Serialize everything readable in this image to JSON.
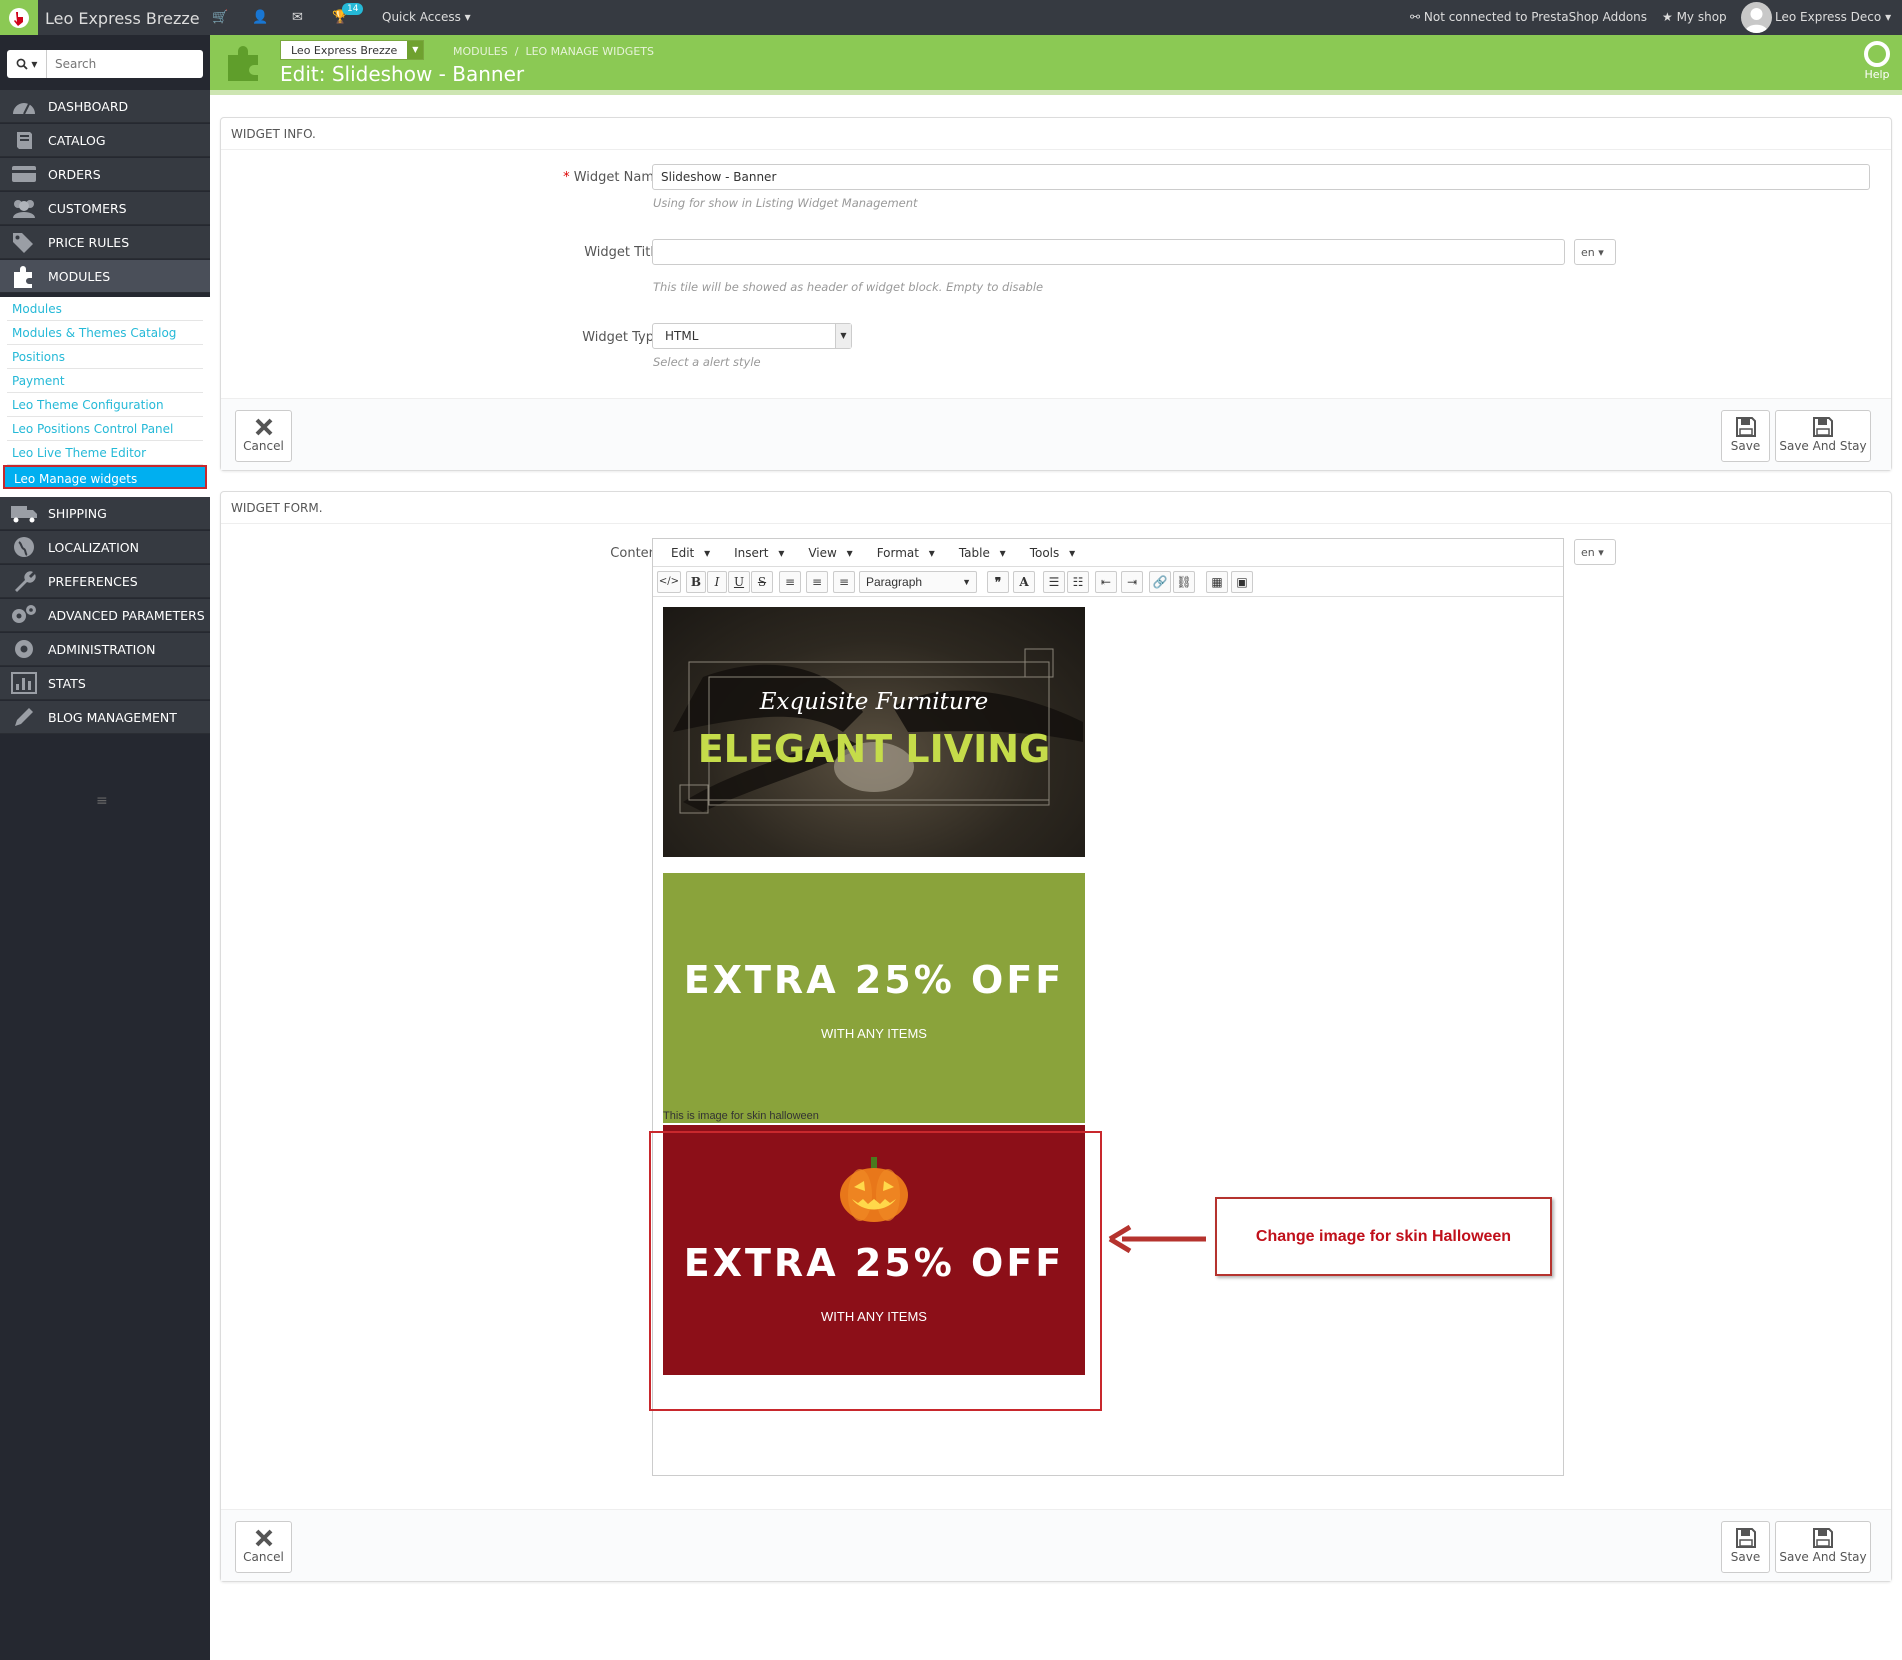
{
  "topbar": {
    "shop_name": "Leo Express Brezze",
    "notifications_count": "14",
    "quick_access": "Quick Access",
    "addons_status": "Not connected to PrestaShop Addons",
    "my_shop": "My shop",
    "employee": "Leo Express Deco"
  },
  "header": {
    "shop_selector": "Leo Express Brezze",
    "breadcrumb_1": "MODULES",
    "breadcrumb_2": "LEO MANAGE WIDGETS",
    "title": "Edit: Slideshow - Banner",
    "help": "Help"
  },
  "sidebar": {
    "search_placeholder": "Search",
    "items": [
      {
        "label": "DASHBOARD"
      },
      {
        "label": "CATALOG"
      },
      {
        "label": "ORDERS"
      },
      {
        "label": "CUSTOMERS"
      },
      {
        "label": "PRICE RULES"
      },
      {
        "label": "MODULES"
      },
      {
        "label": "SHIPPING"
      },
      {
        "label": "LOCALIZATION"
      },
      {
        "label": "PREFERENCES"
      },
      {
        "label": "ADVANCED PARAMETERS"
      },
      {
        "label": "ADMINISTRATION"
      },
      {
        "label": "STATS"
      },
      {
        "label": "BLOG MANAGEMENT"
      }
    ],
    "submenu": [
      "Modules",
      "Modules & Themes Catalog",
      "Positions",
      "Payment",
      "Leo Theme Configuration",
      "Leo Positions Control Panel",
      "Leo Live Theme Editor",
      "Leo Manage widgets"
    ]
  },
  "widget_info": {
    "heading": "WIDGET INFO.",
    "name_label": "Widget Name",
    "name_value": "Slideshow - Banner",
    "name_help": "Using for show in Listing Widget Management",
    "title_label": "Widget Title",
    "title_value": "",
    "title_help": "This tile will be showed as header of widget block. Empty to disable",
    "lang": "en",
    "type_label": "Widget Type",
    "type_value": "HTML",
    "type_help": "Select a alert style",
    "cancel": "Cancel",
    "save": "Save",
    "save_stay": "Save And Stay"
  },
  "widget_form": {
    "heading": "WIDGET FORM.",
    "content_label": "Content",
    "lang": "en",
    "menus": [
      "Edit",
      "Insert",
      "View",
      "Format",
      "Table",
      "Tools"
    ],
    "format_select": "Paragraph",
    "cancel": "Cancel",
    "save": "Save",
    "save_stay": "Save And Stay"
  },
  "banners": {
    "b1_script": "Exquisite Furniture",
    "b1_title": "ELEGANT LIVING",
    "b2_title": "EXTRA 25% OFF",
    "b2_sub": "WITH ANY ITEMS",
    "halloween_caption": "This is image for skin halloween",
    "b3_title": "EXTRA 25% OFF",
    "b3_sub": "WITH ANY ITEMS"
  },
  "annotation": {
    "callout": "Change image for skin Halloween"
  },
  "colors": {
    "brand_green": "#8bc954",
    "topbar": "#363a41",
    "sidebar": "#252830",
    "active_blue": "#00aff0",
    "annotation_red": "#c8282d",
    "halloween_bg": "#8c0f18",
    "offer_bg": "#8aa33b"
  }
}
